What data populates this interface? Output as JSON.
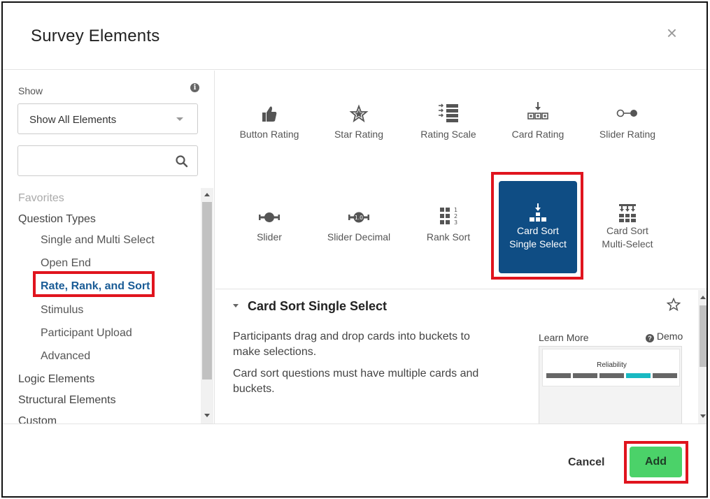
{
  "dialog": {
    "title": "Survey Elements",
    "close_glyph": "×"
  },
  "sidebar": {
    "show_label": "Show",
    "filter": {
      "selected": "Show All Elements"
    },
    "search": {
      "placeholder": "",
      "value": ""
    },
    "nav": {
      "favorites": "Favorites",
      "question_types": "Question Types",
      "single_multi": "Single and Multi Select",
      "open_end": "Open End",
      "rate_rank_sort": "Rate, Rank, and Sort",
      "stimulus": "Stimulus",
      "participant_upload": "Participant Upload",
      "advanced": "Advanced",
      "logic": "Logic Elements",
      "structural": "Structural Elements",
      "custom": "Custom"
    },
    "active_item": "Rate, Rank, and Sort"
  },
  "elements": [
    {
      "label": "Button Rating",
      "icon": "thumbs-up-icon"
    },
    {
      "label": "Star Rating",
      "icon": "star-icon"
    },
    {
      "label": "Rating Scale",
      "icon": "rating-scale-icon"
    },
    {
      "label": "Card Rating",
      "icon": "card-rating-icon"
    },
    {
      "label": "Slider Rating",
      "icon": "slider-rating-icon"
    },
    {
      "label": "Slider",
      "icon": "slider-icon"
    },
    {
      "label": "Slider Decimal",
      "icon": "slider-decimal-icon",
      "badge": "1.0"
    },
    {
      "label": "Rank Sort",
      "icon": "rank-sort-icon",
      "digits": [
        "1",
        "2",
        "3"
      ]
    },
    {
      "label_lines": [
        "Card Sort",
        "Single Select"
      ],
      "icon": "card-sort-single-icon",
      "selected": true
    },
    {
      "label_lines": [
        "Card Sort",
        "Multi-Select"
      ],
      "icon": "card-sort-multi-icon"
    }
  ],
  "detail": {
    "title": "Card Sort Single Select",
    "desc1_line1": "Participants drag and drop cards into buckets to",
    "desc1_line2": "make selections.",
    "desc2_line1": "Card sort questions must have multiple cards and",
    "desc2_line2": "buckets.",
    "learn_more": "Learn More",
    "demo": "Demo",
    "preview_title": "Reliability"
  },
  "footer": {
    "cancel": "Cancel",
    "add": "Add"
  },
  "colors": {
    "selected_tile": "#0f4d84",
    "active_nav": "#1a5c96",
    "add_button": "#4bd269",
    "highlight": "#e0141e"
  }
}
